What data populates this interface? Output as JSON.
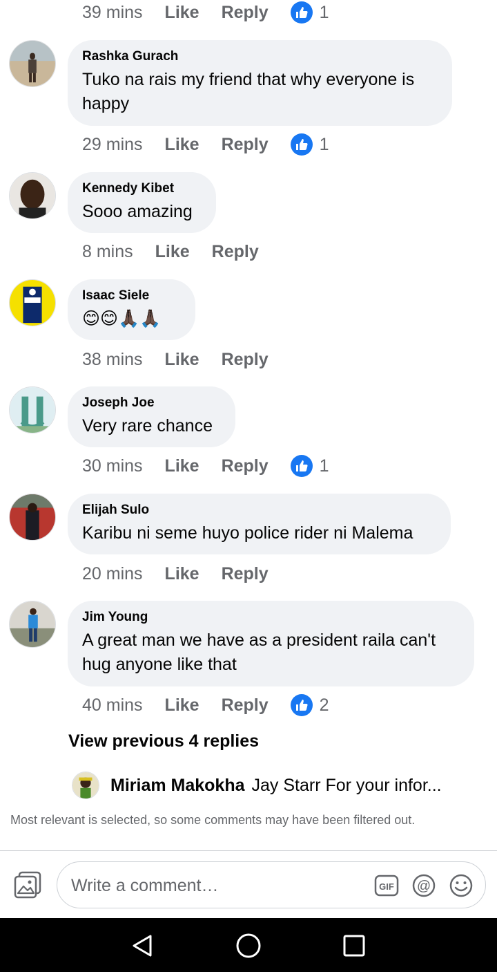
{
  "top_meta": {
    "time": "39 mins",
    "like": "Like",
    "reply": "Reply",
    "likes": "1"
  },
  "comments": [
    {
      "name": "Rashka Gurach",
      "line1": "Tuko na rais my friend that why everyone is",
      "line2": "happy",
      "time": "29 mins",
      "like": "Like",
      "reply": "Reply",
      "likes": "1"
    },
    {
      "name": "Kennedy Kibet",
      "line1": "Sooo amazing",
      "time": "8 mins",
      "like": "Like",
      "reply": "Reply"
    },
    {
      "name": "Isaac Siele",
      "emojis": "😊😊🙏🏿🙏🏿",
      "time": "38 mins",
      "like": "Like",
      "reply": "Reply"
    },
    {
      "name": "Joseph Joe",
      "line1": "Very rare chance",
      "time": "30 mins",
      "like": "Like",
      "reply": "Reply",
      "likes": "1"
    },
    {
      "name": "Elijah Sulo",
      "line1": "Karibu ni seme huyo police rider ni Malema",
      "time": "20 mins",
      "like": "Like",
      "reply": "Reply"
    },
    {
      "name": "Jim Young",
      "line1": "A great man we have as a president raila can't",
      "line2": "hug anyone like that",
      "time": "40 mins",
      "like": "Like",
      "reply": "Reply",
      "likes": "2"
    }
  ],
  "view_previous": "View previous 4 replies",
  "reply_preview": {
    "name": "Miriam Makokha",
    "text": "Jay Starr For your infor..."
  },
  "filter_note": "Most relevant is selected, so some comments may have been filtered out.",
  "composer": {
    "placeholder": "Write a comment…"
  },
  "icons": {
    "like_badge": "thumbs-up-icon",
    "photo": "photo-gallery-icon",
    "gif": "gif-icon",
    "mention": "at-sign-icon",
    "emoji": "smiley-icon",
    "nav_back": "back-triangle-icon",
    "nav_home": "home-circle-icon",
    "nav_recent": "recents-square-icon"
  },
  "colors": {
    "accent": "#1877f2",
    "bubble": "#f0f2f5",
    "secondary_text": "#65676b"
  }
}
